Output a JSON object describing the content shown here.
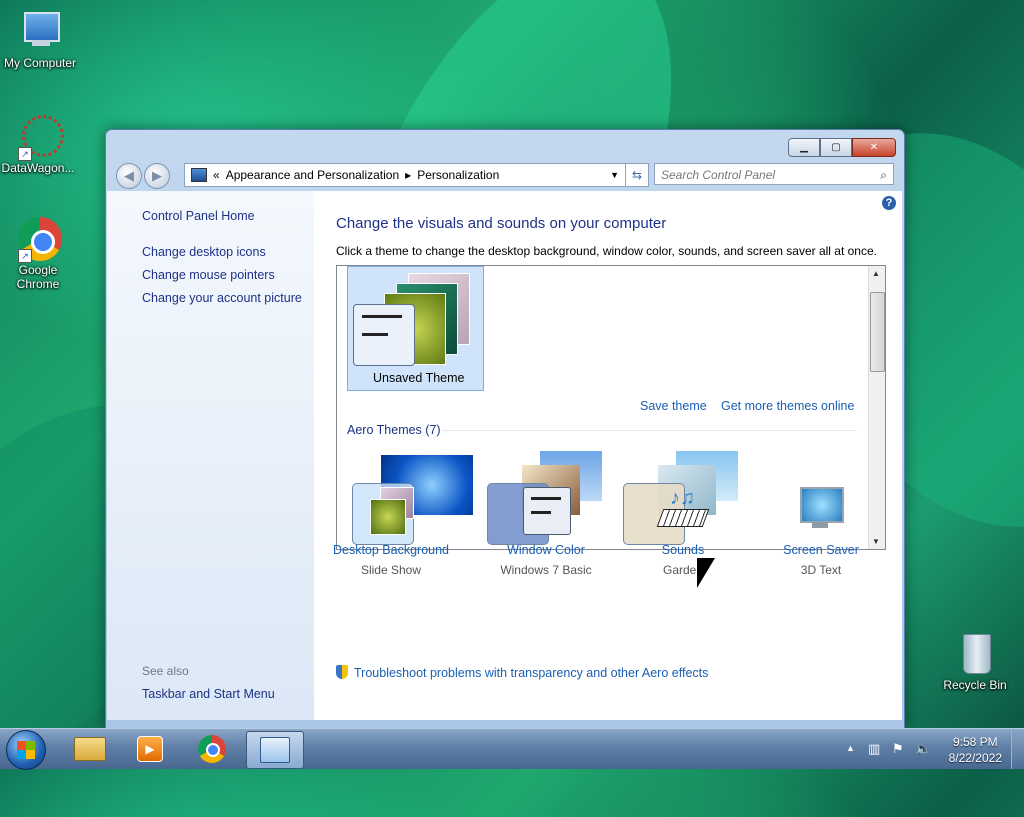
{
  "desktop": {
    "icons": [
      {
        "label": "My Computer"
      },
      {
        "label": "DataWagon..."
      },
      {
        "label_line1": "Google",
        "label_line2": "Chrome"
      },
      {
        "label": "Recycle Bin"
      }
    ]
  },
  "window": {
    "controls": {
      "minimize": "▁",
      "maximize": "▢",
      "close": "✕"
    },
    "address": {
      "prefix": "«",
      "crumb1": "Appearance and Personalization",
      "sep": "▸",
      "crumb2": "Personalization"
    },
    "search": {
      "placeholder": "Search Control Panel"
    },
    "left_nav": {
      "home": "Control Panel Home",
      "links": [
        "Change desktop icons",
        "Change mouse pointers",
        "Change your account picture"
      ],
      "see_also_header": "See also",
      "see_also": [
        "Taskbar and Start Menu"
      ]
    },
    "main": {
      "title": "Change the visuals and sounds on your computer",
      "subtitle": "Click a theme to change the desktop background, window color, sounds, and screen saver all at once.",
      "help": "?",
      "unsaved_theme": "Unsaved Theme",
      "save_theme": "Save theme",
      "get_more": "Get more themes online",
      "aero_section": "Aero Themes (7)",
      "bottom": [
        {
          "label": "Desktop Background",
          "value": "Slide Show",
          "icon": "desktop-background-icon"
        },
        {
          "label": "Window Color",
          "value": "Windows 7 Basic",
          "icon": "window-color-icon"
        },
        {
          "label": "Sounds",
          "value": "Garden",
          "icon": "sounds-icon"
        },
        {
          "label": "Screen Saver",
          "value": "3D Text",
          "icon": "screen-saver-icon"
        }
      ],
      "troubleshoot": "Troubleshoot problems with transparency and other Aero effects"
    }
  },
  "taskbar": {
    "clock_time": "9:58 PM",
    "clock_date": "8/22/2022",
    "tray_arrow": "▲",
    "pinned": [
      "explorer-icon",
      "media-player-icon",
      "chrome-icon",
      "control-panel-icon"
    ]
  },
  "colors": {
    "link": "#1a5fb4",
    "heading": "#1e3287"
  }
}
